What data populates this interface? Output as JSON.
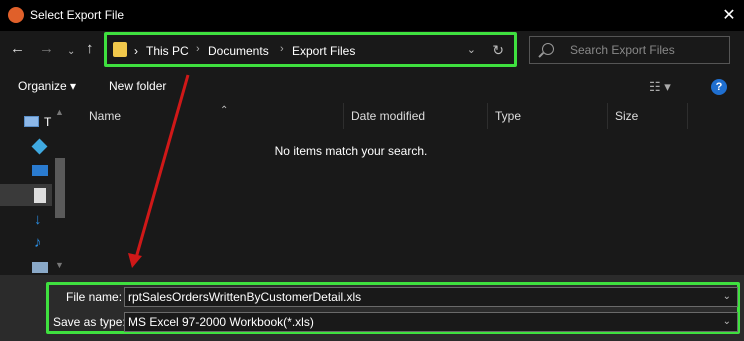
{
  "titlebar": {
    "title": "Select Export File",
    "close_glyph": "✕"
  },
  "nav": {
    "back_glyph": "←",
    "forward_glyph": "→",
    "recent_glyph": "⌄",
    "up_glyph": "↑"
  },
  "address": {
    "crumbs": [
      "This PC",
      "Documents",
      "Export Files"
    ],
    "separator": "›",
    "dropdown_glyph": "⌄",
    "refresh_glyph": "↻"
  },
  "search": {
    "placeholder": "Search Export Files"
  },
  "toolbar": {
    "organize_label": "Organize ▾",
    "new_folder_label": "New folder",
    "view_glyph": "☷ ▾",
    "help_glyph": "?"
  },
  "nav_pane": {
    "this_pc_label": "T"
  },
  "file_list": {
    "columns": [
      "Name",
      "Date modified",
      "Type",
      "Size"
    ],
    "sort_glyph": "⌃",
    "empty_message": "No items match your search."
  },
  "footer": {
    "file_name_label": "File name:",
    "file_name_value": "rptSalesOrdersWrittenByCustomerDetail.xls",
    "save_type_label": "Save as type:",
    "save_type_value": "MS Excel 97-2000 Workbook(*.xls)",
    "caret_glyph": "⌄"
  },
  "colors": {
    "highlight_box": "#3fe03f",
    "annotation_arrow": "#d01818",
    "window_bg": "#191919",
    "footer_bg": "#2b2b2b"
  },
  "icons": [
    "app-icon",
    "close-icon",
    "back-arrow-icon",
    "forward-arrow-icon",
    "recent-locations-icon",
    "up-arrow-icon",
    "folder-icon",
    "refresh-icon",
    "search-icon",
    "view-options-icon",
    "help-icon",
    "this-pc-icon",
    "3d-objects-icon",
    "desktop-icon",
    "documents-icon",
    "downloads-icon",
    "music-icon",
    "pictures-icon"
  ]
}
